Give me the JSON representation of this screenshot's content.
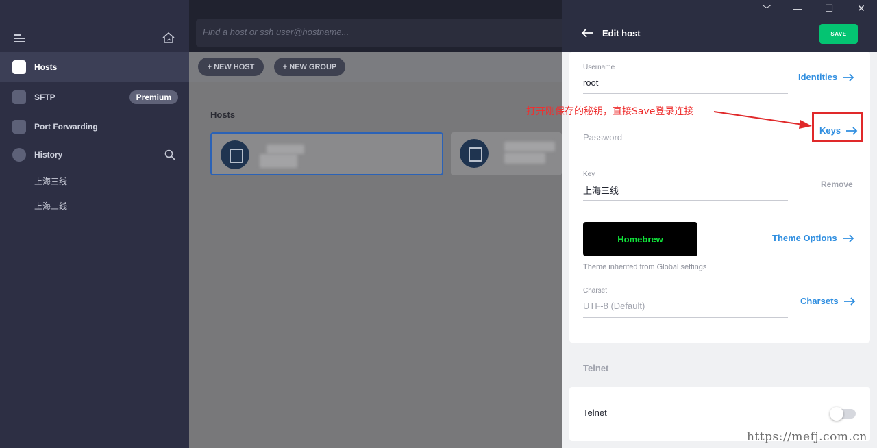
{
  "sidebar": {
    "nav": [
      {
        "label": "Hosts"
      },
      {
        "label": "SFTP",
        "badge": "Premium"
      },
      {
        "label": "Port Forwarding"
      },
      {
        "label": "History"
      }
    ],
    "history": [
      "上海三线",
      "上海三线"
    ]
  },
  "topbar": {
    "search_placeholder": "Find a host or ssh user@hostname..."
  },
  "main": {
    "new_host_label": "+ NEW HOST",
    "new_group_label": "+ NEW GROUP",
    "section_title": "Hosts"
  },
  "panel": {
    "window_controls": [
      "﹀",
      "—",
      "☐",
      "✕"
    ],
    "title": "Edit host",
    "save_label": "SAVE",
    "username_label": "Username",
    "username_value": "root",
    "identities_link": "Identities",
    "password_placeholder": "Password",
    "keys_link": "Keys",
    "key_label": "Key",
    "key_value": "上海三线",
    "remove_label": "Remove",
    "theme_name": "Homebrew",
    "theme_options_link": "Theme Options",
    "theme_note": "Theme inherited from Global settings",
    "charset_label": "Charset",
    "charset_value": "UTF-8 (Default)",
    "charsets_link": "Charsets",
    "telnet_section": "Telnet",
    "telnet_label": "Telnet",
    "telnet_enabled": false
  },
  "annotation": {
    "text": "打开刚保存的秘钥，直接Save登录连接",
    "color": "#ee3030"
  },
  "watermark": "https://mefj.com.cn"
}
